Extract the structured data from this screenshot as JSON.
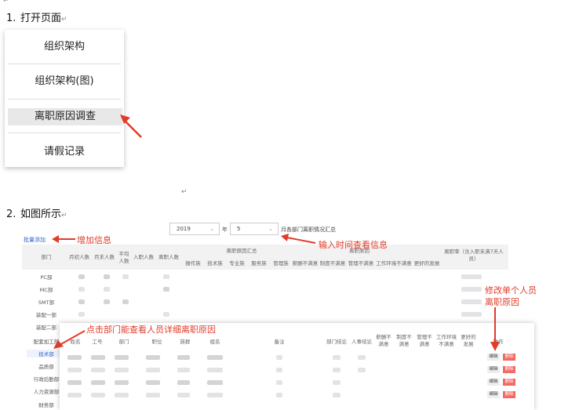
{
  "doc": {
    "top_mark": "↵",
    "step1": {
      "num": "1.",
      "text": "打开页面",
      "mark": "↵"
    },
    "menu": {
      "items": [
        "组织架构",
        "组织架构(图)",
        "离职原因调查",
        "请假记录"
      ],
      "active_index": 2
    },
    "mid_mark": "↵",
    "step2": {
      "num": "2.",
      "text": "如图所示",
      "mark": "↵"
    }
  },
  "shot": {
    "year": "2019",
    "year_label": "年",
    "month": "5",
    "title": "月各部门离职情况汇总",
    "add_link": "批量添加",
    "headers": {
      "dept": "部门",
      "cols": [
        "月初人数",
        "月末人数",
        "平均人数",
        "入职人数",
        "离职人数"
      ],
      "group_reason_summary": "离职原因汇总",
      "group_reason": "离职原因",
      "reason_cols": [
        "操作族",
        "技术族",
        "专业族",
        "服务族",
        "管理族",
        "薪酬不满意",
        "制度不满意",
        "管理不满意",
        "工作环境不满意",
        "更好的发展"
      ],
      "rate": "离职率（含入职未满7天人员）"
    },
    "depts": [
      "PC部",
      "MC部",
      "SMT部",
      "装配一部",
      "装配二部",
      "配套加工部",
      "技术部",
      "品质部",
      "行政后勤部",
      "人力资源部",
      "财务部"
    ],
    "popup_headers": [
      "姓名",
      "工号",
      "部门",
      "职位",
      "族群",
      "组名",
      "备注",
      "部门结论",
      "人事结论",
      "薪酬不满意",
      "制度不满意",
      "管理不满意",
      "工作环境不满意",
      "更好的发展",
      "操作"
    ],
    "edit_label": "编辑",
    "delete_label": "删除",
    "annotations": {
      "add": "增加信息",
      "time": "输入时间查看信息",
      "modify_line1": "修改单个人员",
      "modify_line2": "离职原因",
      "dept_click": "点击部门能查看人员详细离职原因"
    },
    "accent_red": "#e23b2a"
  }
}
